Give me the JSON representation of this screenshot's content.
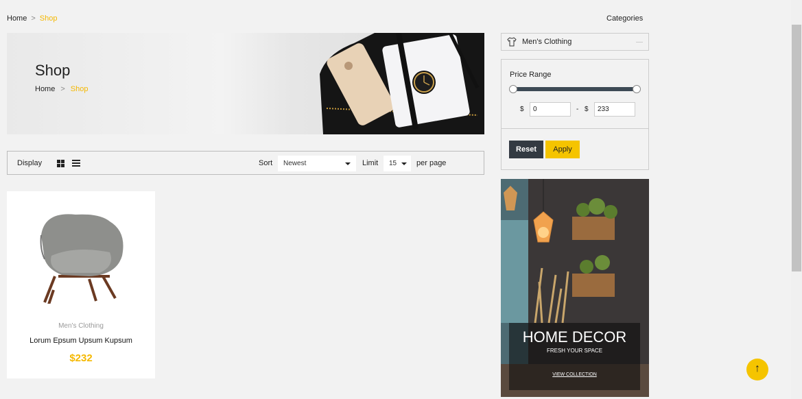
{
  "breadcrumb": {
    "home": "Home",
    "sep": ">",
    "current": "Shop"
  },
  "sidebar": {
    "title": "Categories",
    "category": "Men's Clothing",
    "price": {
      "title": "Price Range",
      "currency": "$",
      "min": "0",
      "max": "233",
      "reset": "Reset",
      "apply": "Apply"
    },
    "promo": {
      "title": "HOME DECOR",
      "subtitle": "FRESH YOUR SPACE",
      "link": "VIEW COLLECTION"
    }
  },
  "hero": {
    "title": "Shop",
    "crumb_home": "Home",
    "crumb_sep": ">",
    "crumb_current": "Shop"
  },
  "toolbar": {
    "display": "Display",
    "sort": "Sort",
    "sort_value": "Newest",
    "limit": "Limit",
    "limit_value": "15",
    "per_page": "per page"
  },
  "products": [
    {
      "category": "Men's Clothing",
      "name": "Lorum Epsum Upsum Kupsum",
      "price": "$232"
    }
  ],
  "scroll_top": "↑",
  "colors": {
    "accent": "#f5c400",
    "dark": "#333a42"
  }
}
